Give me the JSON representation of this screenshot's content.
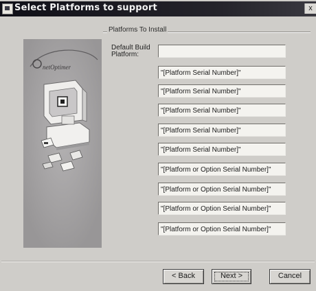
{
  "window": {
    "title": "Select Platforms to support",
    "close_glyph": "x"
  },
  "group": {
    "label": "Platforms To Install"
  },
  "default_build": {
    "label": "Default Build Platform:",
    "value": ""
  },
  "platform_fields": [
    "\"[Platform Serial Number]\"",
    "\"[Platform Serial Number]\"",
    "\"[Platform Serial Number]\"",
    "\"[Platform Serial Number]\"",
    "\"[Platform Serial Number]\"",
    "\"[Platform or Option Serial Number]\"",
    "\"[Platform or Option Serial Number]\"",
    "\"[Platform or Option Serial Number]\"",
    "\"[Platform or Option Serial Number]\""
  ],
  "buttons": {
    "back": "< Back",
    "next": "Next >",
    "cancel": "Cancel"
  },
  "panel": {
    "logo_text": "netOptimer"
  },
  "colors": {
    "titlebar": "#101018",
    "dialog_bg": "#cfcdc9",
    "side_panel": "#a19fa0"
  }
}
